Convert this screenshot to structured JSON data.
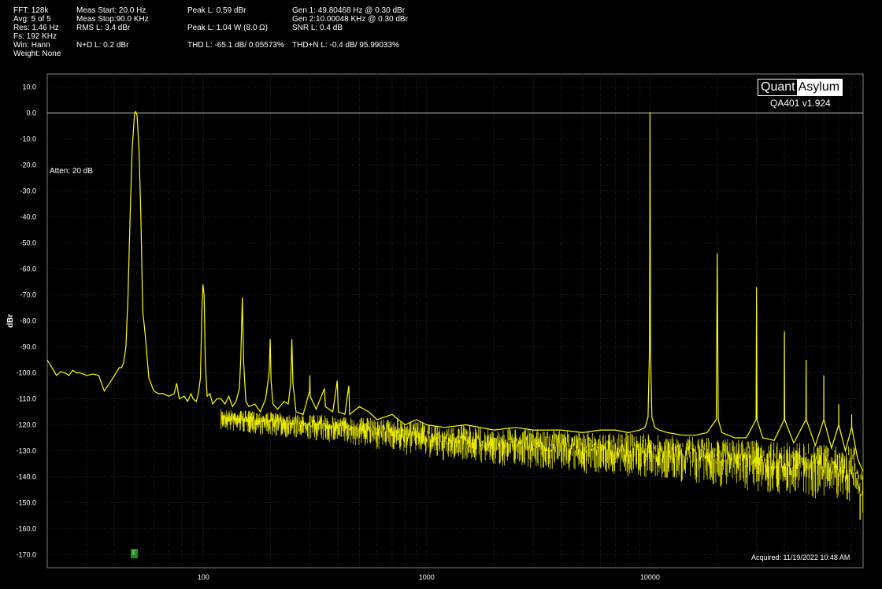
{
  "measurements": {
    "col1": [
      "FFT: 128k",
      "Avg: 5 of 5",
      "Res: 1.46 Hz",
      "Fs: 192 KHz",
      "Win: Hann",
      "Weight: None"
    ],
    "col2": [
      "Meas Start: 20.0 Hz",
      "Meas Stop:90.0 KHz",
      "RMS L: 3.4 dBr",
      "N+D L: 0.2 dBr"
    ],
    "col3": [
      "Peak L: 0.59 dBr",
      "Peak L: 1.04 W (8.0 Ω)",
      "THD L: -65.1 dB/ 0.05573%"
    ],
    "col4": [
      "Gen 1: 49.80468 Hz @ 0.30  dBr",
      "Gen 2:10.00048 KHz @ 0.30  dBr",
      "SNR L: 0.4 dB",
      "THD+N L: -0.4 dB/ 95.99033%"
    ]
  },
  "logo": {
    "left": "Quant",
    "right": "Asylum"
  },
  "version": "QA401 v1.924",
  "acquired": "Acquired: 11/19/2022  10:48 AM",
  "atten": "Atten: 20 dB",
  "marker_label": "F",
  "colors": {
    "background": "#000000",
    "plot_background": "#000000",
    "grid": "#2a2a2a",
    "trace": "#ffff00",
    "reference_line": "#c8c8c8",
    "marker": "#1f8a1f"
  },
  "chart_data": {
    "type": "line",
    "title": "",
    "xlabel": "",
    "ylabel": "dBr",
    "x_scale": "log",
    "xlim": [
      20,
      90000
    ],
    "ylim": [
      -175,
      15
    ],
    "y_ticks": [
      10,
      0,
      -10,
      -20,
      -30,
      -40,
      -50,
      -60,
      -70,
      -80,
      -90,
      -100,
      -110,
      -120,
      -130,
      -140,
      -150,
      -160,
      -170
    ],
    "y_tick_labels": [
      "10.0",
      "0.0",
      "-10.0",
      "-20.0",
      "-30.0",
      "-40.0",
      "-50.0",
      "-60.0",
      "-70.0",
      "-80.0",
      "-90.0",
      "-100.0",
      "-110.0",
      "-120.0",
      "-130.0",
      "-140.0",
      "-150.0",
      "-160.0",
      "-170.0"
    ],
    "x_ticks": [
      100,
      1000,
      10000
    ],
    "x_tick_labels": [
      "100",
      "1000",
      "10000"
    ],
    "reference_line_y": 0,
    "grid": true,
    "series": [
      {
        "points": [
          [
            20,
            -95
          ],
          [
            21,
            -98
          ],
          [
            22,
            -101
          ],
          [
            23,
            -99.5
          ],
          [
            24,
            -100
          ],
          [
            25,
            -101
          ],
          [
            26,
            -99
          ],
          [
            27,
            -100
          ],
          [
            28,
            -100
          ],
          [
            30,
            -101
          ],
          [
            32,
            -100.5
          ],
          [
            34,
            -101
          ],
          [
            35,
            -104
          ],
          [
            36,
            -107
          ],
          [
            38,
            -104
          ],
          [
            40,
            -101
          ],
          [
            42,
            -98
          ],
          [
            43,
            -98
          ],
          [
            44,
            -96
          ],
          [
            45,
            -90
          ],
          [
            46,
            -70
          ],
          [
            47,
            -40
          ],
          [
            48,
            -14
          ],
          [
            49.2,
            0
          ],
          [
            49.8,
            0.59
          ],
          [
            50.5,
            -1
          ],
          [
            51.5,
            -14
          ],
          [
            52.5,
            -40
          ],
          [
            53.5,
            -76
          ],
          [
            55,
            -86
          ],
          [
            57,
            -102
          ],
          [
            60,
            -107
          ],
          [
            63,
            -108
          ],
          [
            66,
            -108
          ],
          [
            70,
            -109
          ],
          [
            74,
            -108
          ],
          [
            76,
            -104
          ],
          [
            78,
            -110
          ],
          [
            82,
            -109
          ],
          [
            85,
            -111
          ],
          [
            88,
            -108
          ],
          [
            90,
            -110
          ],
          [
            93,
            -111
          ],
          [
            95,
            -108
          ],
          [
            97,
            -102
          ],
          [
            98.5,
            -76
          ],
          [
            99.6,
            -66
          ],
          [
            100.8,
            -70
          ],
          [
            102,
            -96
          ],
          [
            104,
            -109
          ],
          [
            107,
            -108
          ],
          [
            110,
            -112
          ],
          [
            115,
            -110
          ],
          [
            120,
            -110
          ],
          [
            125,
            -112
          ],
          [
            130,
            -109
          ],
          [
            135,
            -113
          ],
          [
            140,
            -111
          ],
          [
            145,
            -106
          ],
          [
            147,
            -95
          ],
          [
            149.4,
            -71
          ],
          [
            151.5,
            -96
          ],
          [
            155,
            -111
          ],
          [
            160,
            -113
          ],
          [
            170,
            -112
          ],
          [
            180,
            -115
          ],
          [
            190,
            -110
          ],
          [
            197,
            -100
          ],
          [
            199.2,
            -87
          ],
          [
            201,
            -103
          ],
          [
            205,
            -112
          ],
          [
            215,
            -114
          ],
          [
            230,
            -111
          ],
          [
            240,
            -112
          ],
          [
            246,
            -104
          ],
          [
            249,
            -87
          ],
          [
            252,
            -104
          ],
          [
            260,
            -115
          ],
          [
            280,
            -116
          ],
          [
            299,
            -107
          ],
          [
            300,
            -101
          ],
          [
            301,
            -109
          ],
          [
            320,
            -114
          ],
          [
            348.6,
            -106
          ],
          [
            352,
            -113
          ],
          [
            380,
            -115
          ],
          [
            398,
            -103
          ],
          [
            402,
            -115
          ],
          [
            430,
            -116
          ],
          [
            448,
            -105
          ],
          [
            452,
            -116
          ],
          [
            500,
            -113
          ],
          [
            550,
            -115
          ],
          [
            600,
            -118
          ],
          [
            700,
            -116
          ],
          [
            800,
            -120
          ],
          [
            900,
            -118
          ],
          [
            1000,
            -120
          ],
          [
            1200,
            -121
          ],
          [
            1500,
            -120
          ],
          [
            2000,
            -122
          ],
          [
            2500,
            -121
          ],
          [
            3000,
            -122
          ],
          [
            4000,
            -122
          ],
          [
            5000,
            -123
          ],
          [
            6000,
            -122
          ],
          [
            7000,
            -122
          ],
          [
            8000,
            -123
          ],
          [
            9000,
            -122
          ],
          [
            9500,
            -121
          ],
          [
            9800,
            -117
          ],
          [
            9950,
            -90
          ],
          [
            10000,
            0.3
          ],
          [
            10050,
            -90
          ],
          [
            10200,
            -117
          ],
          [
            10500,
            -121
          ],
          [
            11000,
            -122
          ],
          [
            12000,
            -123
          ],
          [
            14000,
            -124
          ],
          [
            16000,
            -124
          ],
          [
            18000,
            -123
          ],
          [
            19800,
            -118
          ],
          [
            20000,
            -54
          ],
          [
            20200,
            -118
          ],
          [
            21000,
            -123
          ],
          [
            24000,
            -125
          ],
          [
            27000,
            -125
          ],
          [
            29850,
            -118
          ],
          [
            30000,
            -67
          ],
          [
            30150,
            -118
          ],
          [
            32000,
            -125
          ],
          [
            36000,
            -126
          ],
          [
            39900,
            -118
          ],
          [
            40000,
            -84
          ],
          [
            40100,
            -118
          ],
          [
            44000,
            -127
          ],
          [
            49900,
            -118
          ],
          [
            50000,
            -95
          ],
          [
            50100,
            -118
          ],
          [
            55000,
            -128
          ],
          [
            59950,
            -118
          ],
          [
            60000,
            -101
          ],
          [
            60050,
            -118
          ],
          [
            65000,
            -129
          ],
          [
            69950,
            -120
          ],
          [
            70000,
            -112
          ],
          [
            70050,
            -120
          ],
          [
            75000,
            -130
          ],
          [
            79950,
            -121
          ],
          [
            80000,
            -116
          ],
          [
            80050,
            -121
          ],
          [
            85000,
            -133
          ],
          [
            88000,
            -136
          ],
          [
            90000,
            -138
          ]
        ]
      }
    ]
  }
}
